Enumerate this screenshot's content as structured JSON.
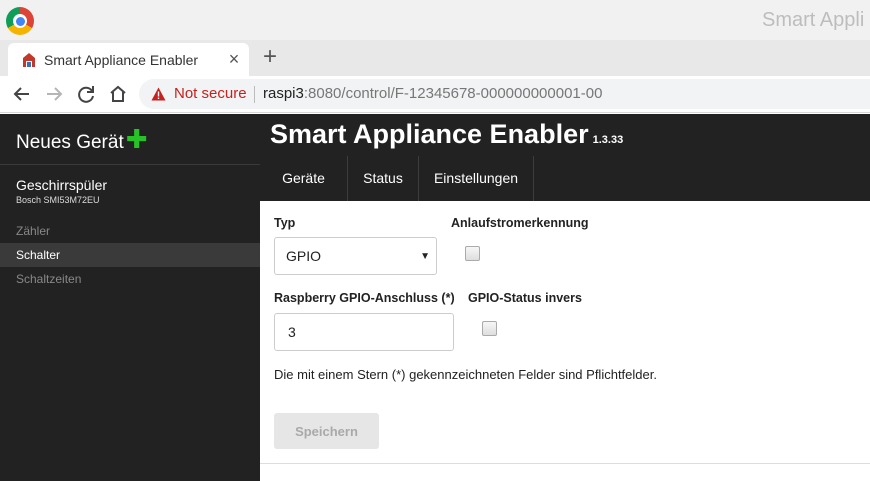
{
  "browser": {
    "window_title": "Smart Appli",
    "tab_title": "Smart Appliance Enabler",
    "tab_close_icon": "×",
    "new_tab_icon": "+",
    "security_label": "Not secure",
    "url_host": "raspi3",
    "url_rest": ":8080/control/F-12345678-000000000001-00"
  },
  "sidebar": {
    "brand": "Neues Gerät",
    "brand_plus": "✚",
    "device_name": "Geschirrspüler",
    "device_model": "Bosch SMI53M72EU",
    "items": [
      {
        "label": "Zähler",
        "active": false
      },
      {
        "label": "Schalter",
        "active": true
      },
      {
        "label": "Schaltzeiten",
        "active": false
      }
    ]
  },
  "header": {
    "title": "Smart Appliance Enabler",
    "version": "1.3.33",
    "tabs": [
      {
        "label": "Geräte"
      },
      {
        "label": "Status"
      },
      {
        "label": "Einstellungen"
      }
    ]
  },
  "form": {
    "type_label": "Typ",
    "type_value": "GPIO",
    "inrush_label": "Anlaufstromerkennung",
    "inrush_checked": false,
    "gpio_label": "Raspberry GPIO-Anschluss (*)",
    "gpio_value": "3",
    "invert_label": "GPIO-Status invers",
    "invert_checked": false,
    "hint": "Die mit einem Stern (*) gekennzeichneten Felder sind Pflichtfelder.",
    "save_label": "Speichern"
  },
  "colors": {
    "sidebar_bg": "#222222",
    "active_item_bg": "#3a3a3a",
    "accent_plus": "#28c128",
    "not_secure": "#c5221f"
  }
}
